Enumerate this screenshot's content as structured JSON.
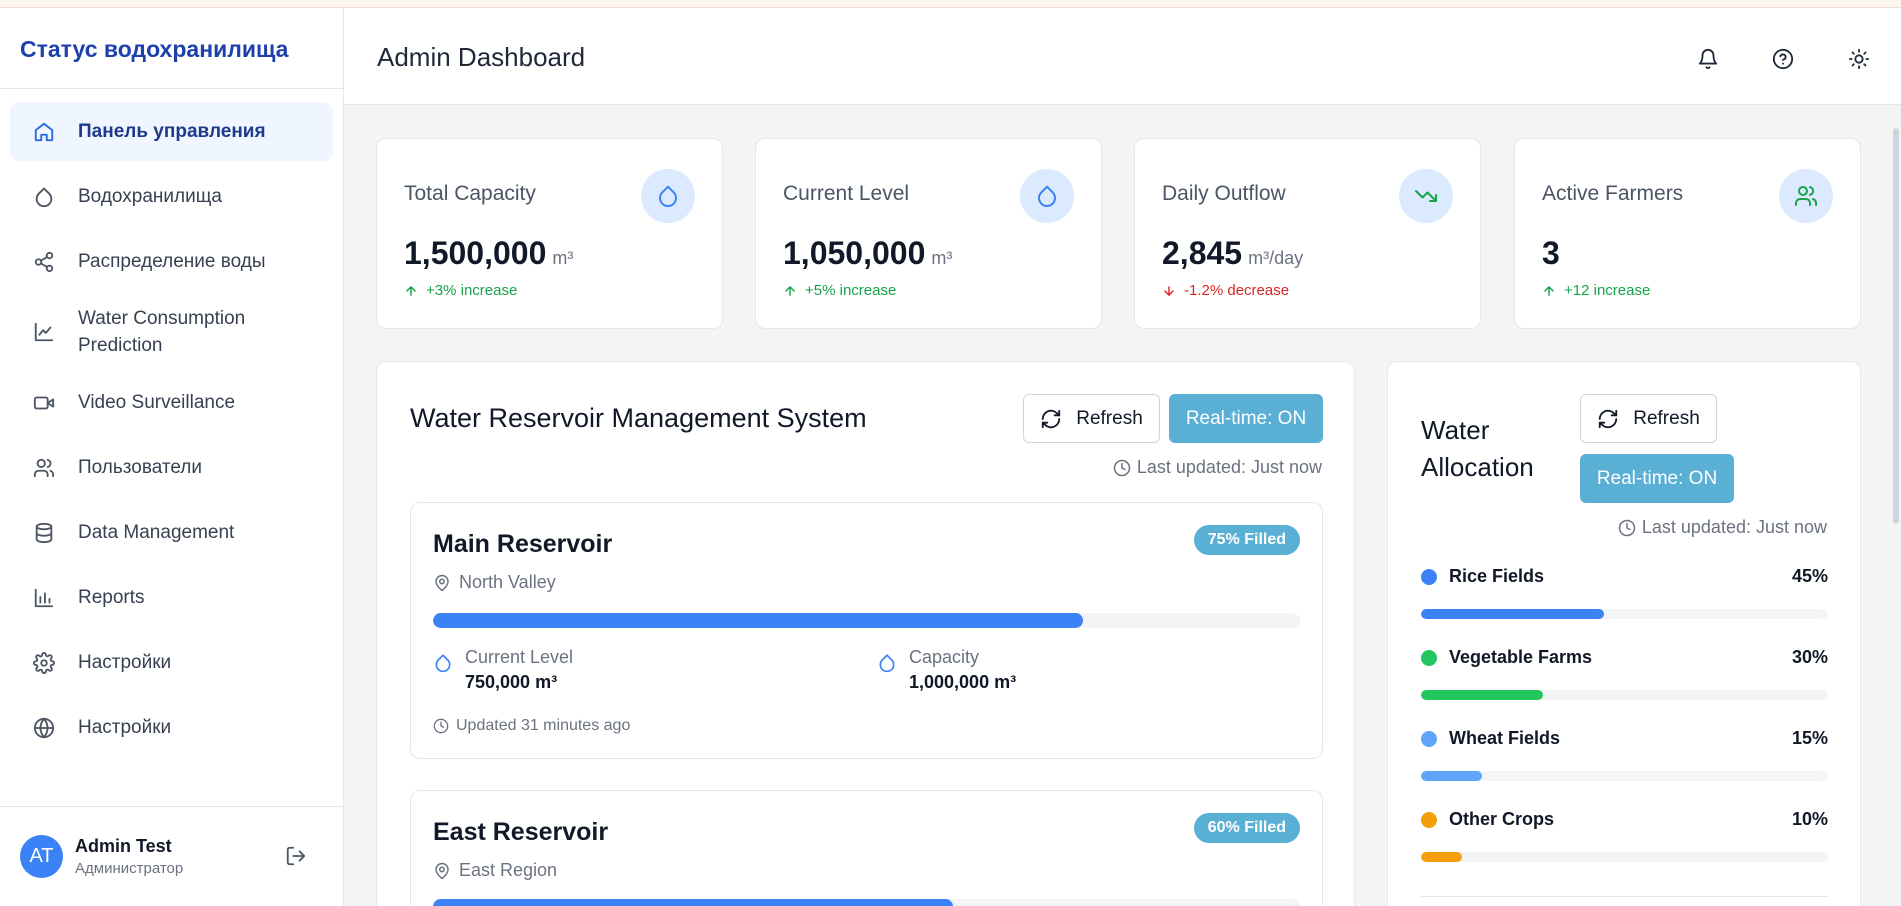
{
  "sidebar": {
    "brand": "Статус водохранилища",
    "items": [
      {
        "label": "Панель управления",
        "icon": "home-icon",
        "active": true
      },
      {
        "label": "Водохранилища",
        "icon": "droplet-icon"
      },
      {
        "label": "Распределение воды",
        "icon": "share-icon"
      },
      {
        "label": "Water Consumption Prediction",
        "icon": "line-chart-icon"
      },
      {
        "label": "Video Surveillance",
        "icon": "video-icon"
      },
      {
        "label": "Пользователи",
        "icon": "users-icon"
      },
      {
        "label": "Data Management",
        "icon": "database-icon"
      },
      {
        "label": "Reports",
        "icon": "bar-chart-icon"
      },
      {
        "label": "Настройки",
        "icon": "gear-icon"
      },
      {
        "label": "Настройки",
        "icon": "globe-icon"
      }
    ],
    "user": {
      "initials": "AT",
      "name": "Admin Test",
      "role": "Администратор"
    }
  },
  "header": {
    "title": "Admin Dashboard"
  },
  "stats": [
    {
      "label": "Total Capacity",
      "value": "1,500,000",
      "unit": "m³",
      "change": "+3% increase",
      "trend": "up",
      "icon": "droplet-icon"
    },
    {
      "label": "Current Level",
      "value": "1,050,000",
      "unit": "m³",
      "change": "+5% increase",
      "trend": "up",
      "icon": "droplet-icon"
    },
    {
      "label": "Daily Outflow",
      "value": "2,845",
      "unit": "m³/day",
      "change": "-1.2% decrease",
      "trend": "down",
      "icon": "trending-down-icon"
    },
    {
      "label": "Active Farmers",
      "value": "3",
      "unit": "",
      "change": "+12 increase",
      "trend": "up",
      "icon": "users-icon"
    }
  ],
  "reservoir_panel": {
    "title": "Water Reservoir Management System",
    "refresh_label": "Refresh",
    "realtime_label": "Real-time: ON",
    "last_updated": "Last updated: Just now",
    "reservoirs": [
      {
        "name": "Main Reservoir",
        "badge": "75% Filled",
        "fill_percent": 75,
        "location": "North Valley",
        "level_label": "Current Level",
        "level_value": "750,000 m³",
        "capacity_label": "Capacity",
        "capacity_value": "1,000,000 m³",
        "updated": "Updated 31 minutes ago"
      },
      {
        "name": "East Reservoir",
        "badge": "60% Filled",
        "fill_percent": 60,
        "location": "East Region"
      }
    ]
  },
  "allocation_panel": {
    "title_line1": "Water",
    "title_line2": "Allocation",
    "refresh_label": "Refresh",
    "realtime_label": "Real-time: ON",
    "last_updated": "Last updated: Just now",
    "items": [
      {
        "label": "Rice Fields",
        "percent": "45%",
        "value": 45,
        "color": "#3b82f6"
      },
      {
        "label": "Vegetable Farms",
        "percent": "30%",
        "value": 30,
        "color": "#22c55e"
      },
      {
        "label": "Wheat Fields",
        "percent": "15%",
        "value": 15,
        "color": "#60a5fa"
      },
      {
        "label": "Other Crops",
        "percent": "10%",
        "value": 10,
        "color": "#f59e0b"
      }
    ]
  },
  "colors": {
    "accent": "#3b82f6",
    "badge": "#5aafd4",
    "up": "#16a34a",
    "down": "#dc2626"
  }
}
